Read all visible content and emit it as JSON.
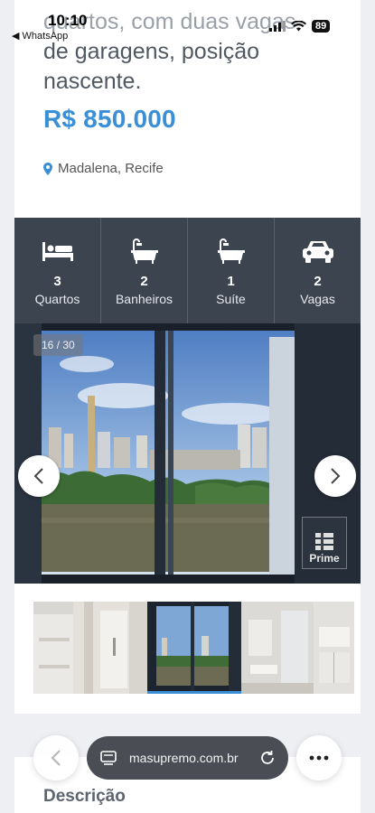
{
  "status_bar": {
    "time": "10:10",
    "back_app": "◀ WhatsApp",
    "battery": "89"
  },
  "listing": {
    "title_top_partial": "quartos, com duas vagas",
    "title_line2": "de garagens, posição",
    "title_line3": "nascente.",
    "price": "R$ 850.000",
    "location": "Madalena, Recife"
  },
  "features": [
    {
      "icon": "bed-icon",
      "value": "3",
      "label": "Quartos"
    },
    {
      "icon": "bathtub-icon",
      "value": "2",
      "label": "Banheiros"
    },
    {
      "icon": "suite-bathtub-icon",
      "value": "1",
      "label": "Suíte"
    },
    {
      "icon": "car-icon",
      "value": "2",
      "label": "Vagas"
    }
  ],
  "gallery": {
    "counter": "16 / 30",
    "badge": "Prime"
  },
  "description": {
    "title": "Descrição"
  },
  "browser": {
    "url": "masupremo.com.br"
  },
  "colors": {
    "accent": "#3a8fd6",
    "features_bg": "#3c4450",
    "page_bg": "#eeeff2"
  }
}
